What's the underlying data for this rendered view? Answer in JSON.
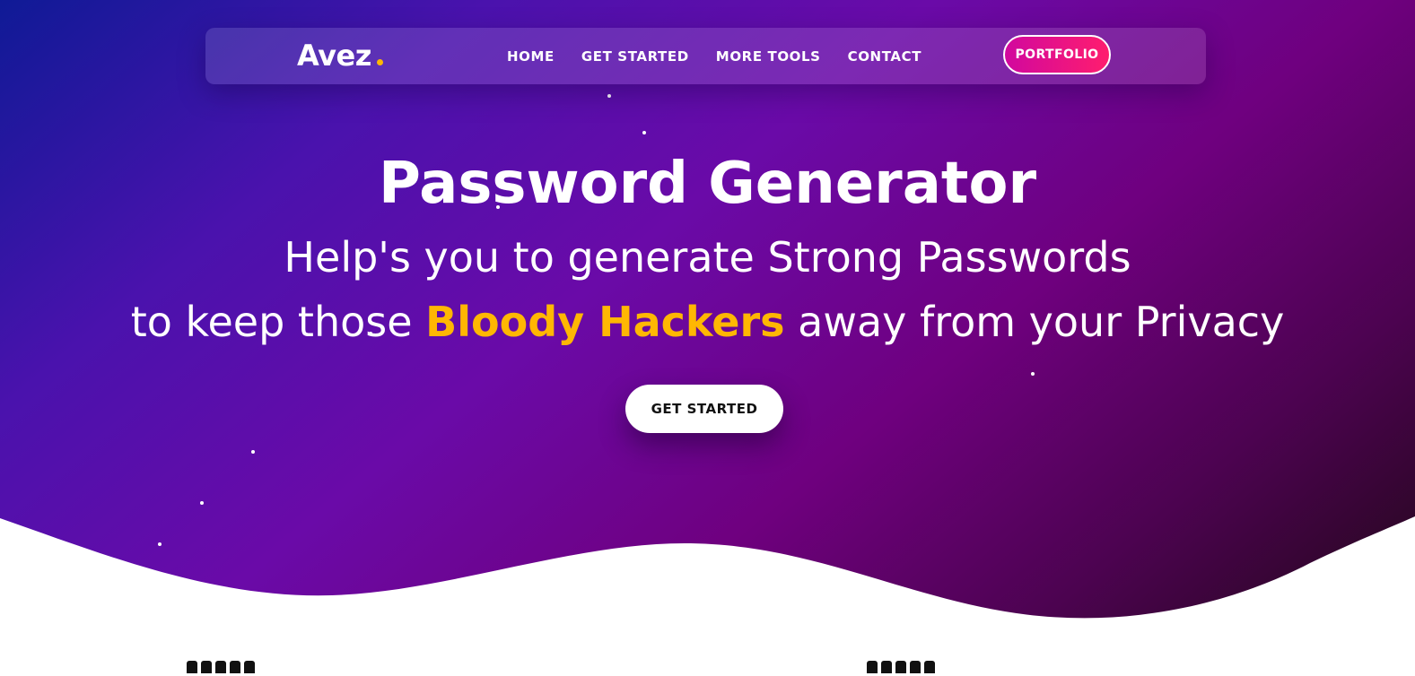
{
  "brand": {
    "logo_text": "Avez",
    "accent_color": "#ffb703"
  },
  "nav": {
    "items": [
      {
        "label": "HOME"
      },
      {
        "label": "GET STARTED"
      },
      {
        "label": "MORE TOOLS"
      },
      {
        "label": "CONTACT"
      }
    ],
    "portfolio_label": "PORTFOLIO"
  },
  "hero": {
    "title": "Password Generator",
    "line1": "Help's you to generate Strong Passwords",
    "line2_before": "to keep those ",
    "line2_highlight": "Bloody Hackers",
    "line2_after": " away from your Privacy",
    "cta_label": "GET STARTED",
    "colors": {
      "gradient_start": "#0f1a96",
      "gradient_mid": "#6a0aa8",
      "gradient_end": "#1c0811",
      "highlight": "#ffb703",
      "portfolio_button": "#e0148c"
    }
  },
  "icons": {
    "logo_dot": "dot-icon"
  }
}
